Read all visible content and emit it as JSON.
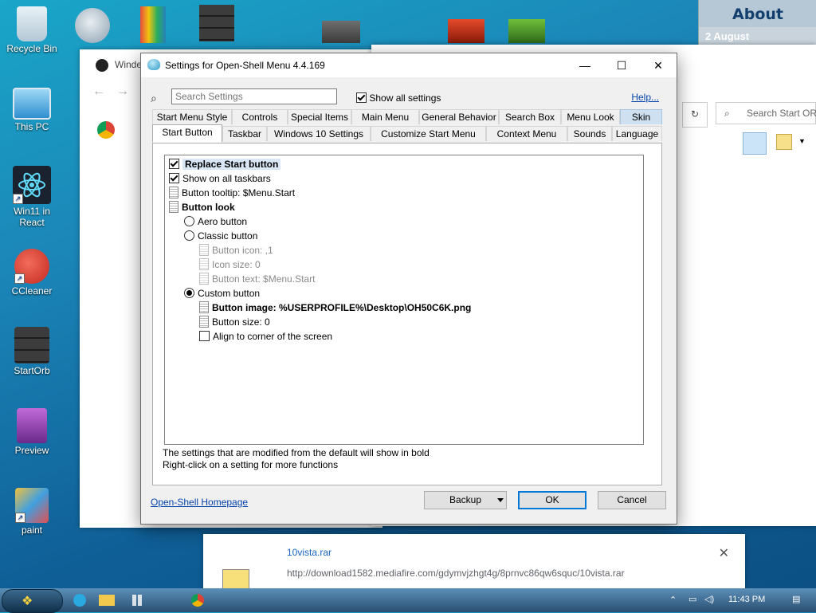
{
  "desktop": {
    "icons": [
      {
        "label": "Recycle Bin"
      },
      {
        "label": "This PC"
      },
      {
        "label": "Win11 in React"
      },
      {
        "label": "CCleaner"
      },
      {
        "label": "StartOrb"
      },
      {
        "label": "Preview"
      },
      {
        "label": "paint"
      }
    ],
    "about_panel": {
      "title": "About",
      "date": "2 August"
    }
  },
  "background_windows": {
    "browser_title": "Winde",
    "explorer_search_placeholder": "Search Start ORB"
  },
  "settings": {
    "window_title": "Settings for Open-Shell Menu 4.4.169",
    "search_placeholder": "Search Settings",
    "show_all_label": "Show all settings",
    "show_all_checked": true,
    "help_label": "Help...",
    "tabs_row1": [
      "Start Menu Style",
      "Controls",
      "Special Items",
      "Main Menu",
      "General Behavior",
      "Search Box",
      "Menu Look",
      "Skin"
    ],
    "tabs_row2": [
      "Start Button",
      "Taskbar",
      "Windows 10 Settings",
      "Customize Start Menu",
      "Context Menu",
      "Sounds",
      "Language"
    ],
    "active_tab": "Start Button",
    "items": [
      {
        "kind": "check",
        "checked": true,
        "label": "Replace Start button",
        "bold": true,
        "highlight": true
      },
      {
        "kind": "check",
        "checked": true,
        "label": "Show on all taskbars"
      },
      {
        "kind": "doc",
        "label": "Button tooltip: $Menu.Start"
      },
      {
        "kind": "doc",
        "label": "Button look",
        "bold": true
      },
      {
        "kind": "radio",
        "on": false,
        "label": "Aero button"
      },
      {
        "kind": "radio",
        "on": false,
        "label": "Classic button"
      },
      {
        "kind": "doc",
        "label": "Button icon: ,1",
        "disabled": true
      },
      {
        "kind": "doc",
        "label": "Icon size: 0",
        "disabled": true
      },
      {
        "kind": "doc",
        "label": "Button text: $Menu.Start",
        "disabled": true
      },
      {
        "kind": "radio",
        "on": true,
        "label": "Custom button"
      },
      {
        "kind": "doc",
        "label": "Button image: %USERPROFILE%\\Desktop\\OH50C6K.png",
        "bold": true
      },
      {
        "kind": "doc",
        "label": "Button size: 0"
      },
      {
        "kind": "check",
        "checked": false,
        "label": "Align to corner of the screen"
      }
    ],
    "note_line1": "The settings that are modified from the default will show in bold",
    "note_line2": "Right-click on a setting for more functions",
    "homepage_link": "Open-Shell Homepage",
    "buttons": {
      "backup": "Backup",
      "ok": "OK",
      "cancel": "Cancel"
    }
  },
  "download": {
    "filename": "10vista.rar",
    "url": "http://download1582.mediafire.com/gdymvjzhgt4g/8prnvc86qw6squc/10vista.rar"
  },
  "taskbar": {
    "clock": "11:43 PM"
  }
}
